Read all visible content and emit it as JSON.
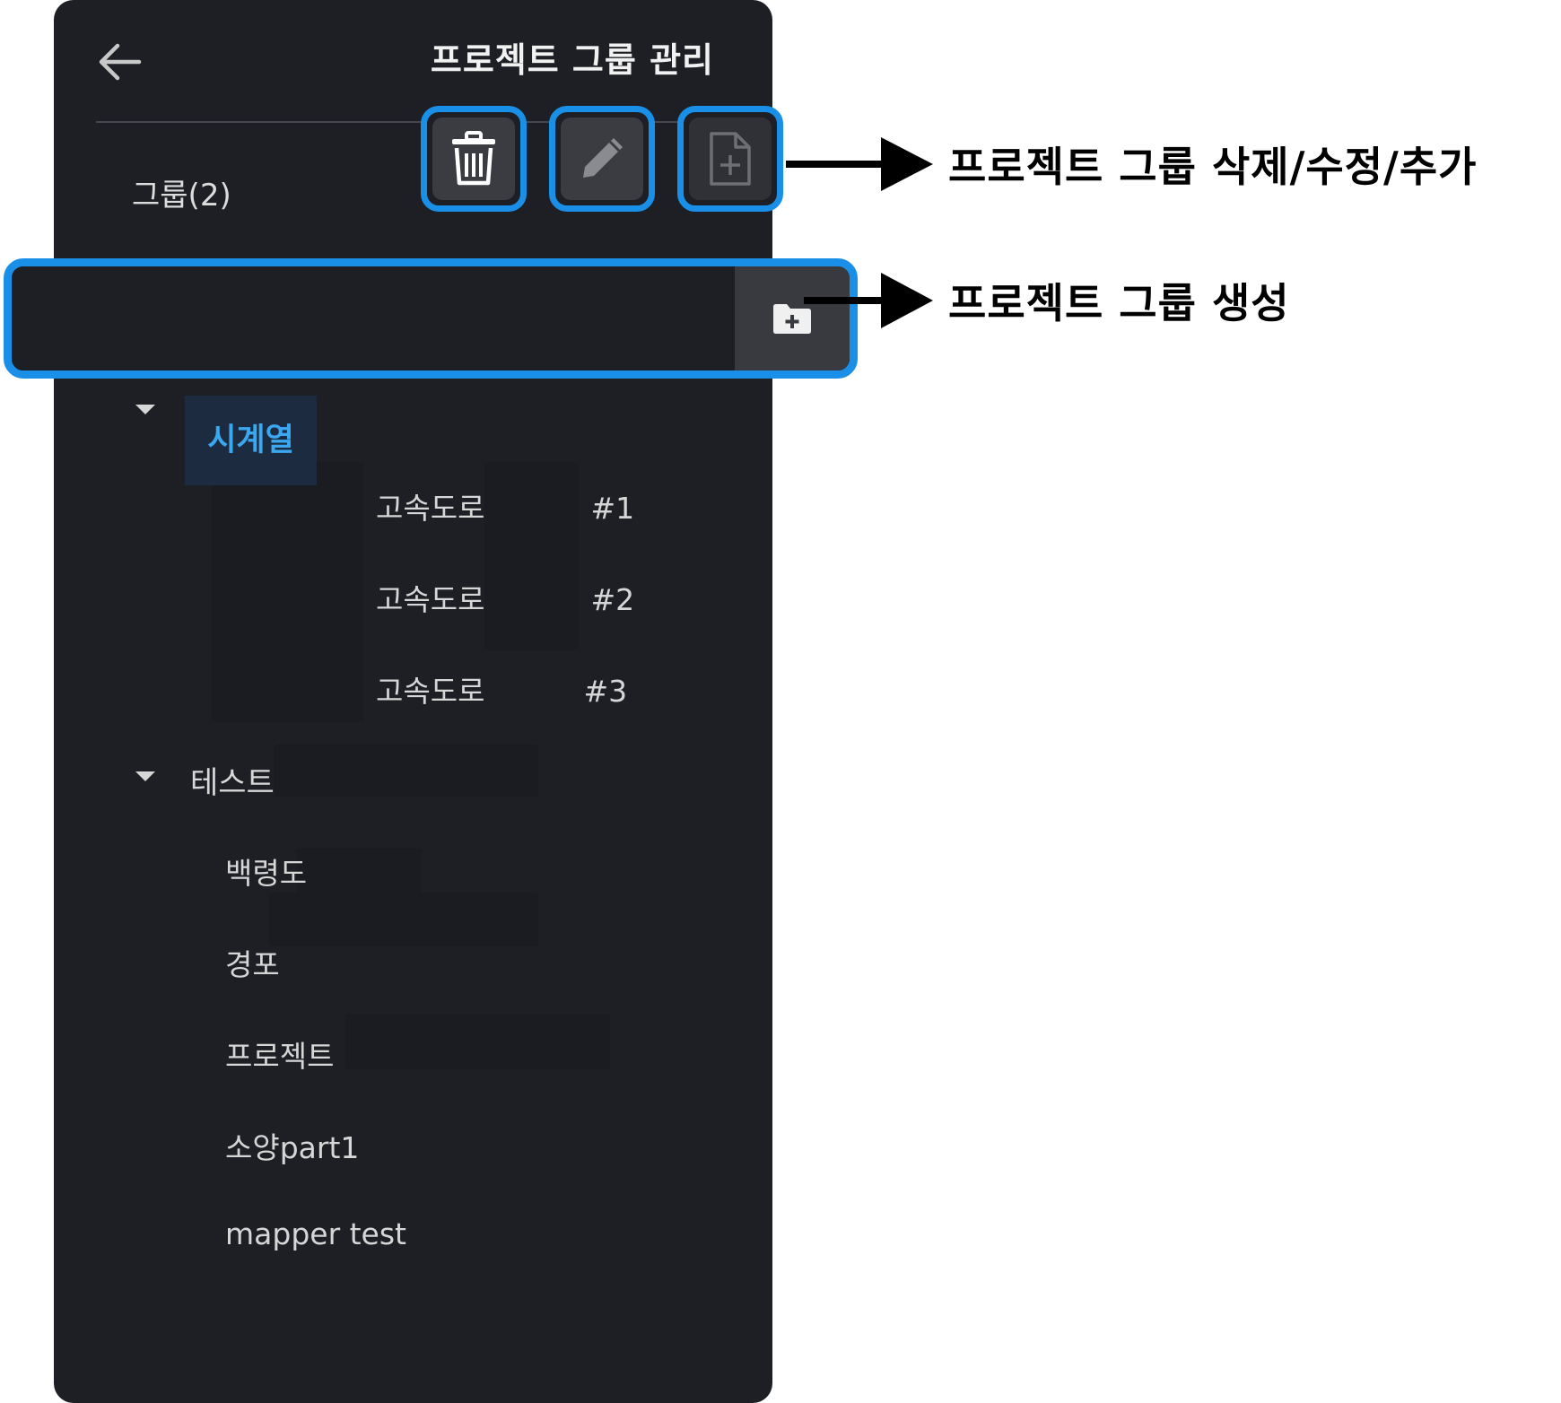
{
  "header": {
    "title": "프로젝트 그룹 관리",
    "back_icon": "arrow-left-icon"
  },
  "group_count": "그룹(2)",
  "actions": {
    "delete_icon": "trash-icon",
    "edit_icon": "pencil-icon",
    "add_icon": "file-plus-icon"
  },
  "create": {
    "value": "",
    "placeholder": "",
    "button_icon": "folder-plus-icon"
  },
  "tree": {
    "groups": [
      {
        "label": "시계열",
        "expanded": true,
        "selected": true,
        "items": [
          {
            "name": "고속도로",
            "num": "#1"
          },
          {
            "name": "고속도로",
            "num": "#2"
          },
          {
            "name": "고속도로",
            "num": "#3"
          }
        ]
      },
      {
        "label": "테스트",
        "expanded": true,
        "selected": false,
        "items": [
          {
            "name": "백령도"
          },
          {
            "name": "경포"
          },
          {
            "name": "프로젝트"
          },
          {
            "name": "소양part1"
          },
          {
            "name": "mapper test"
          }
        ]
      }
    ]
  },
  "annotations": {
    "actions_label": "프로젝트 그룹 삭제/수정/추가",
    "create_label": "프로젝트 그룹 생성"
  },
  "colors": {
    "panel_bg": "#1e1f25",
    "highlight_border": "#1a8fe8",
    "selected_text": "#3aa8f0",
    "selected_bg": "#1d2b40"
  }
}
